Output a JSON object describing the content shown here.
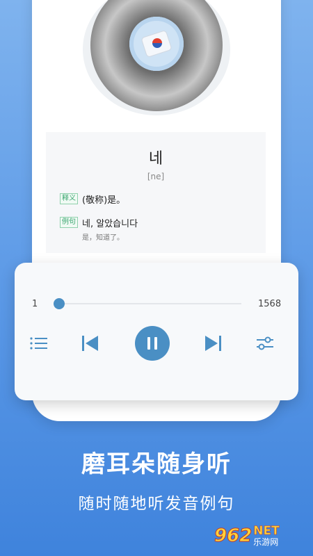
{
  "card": {
    "word": "네",
    "phonetic": "[ne]",
    "meaning_tag": "释义",
    "meaning": "(敬称)是。",
    "example_tag": "例句",
    "example": "네, 알았습니다",
    "example_translation": "是，知道了。"
  },
  "player": {
    "current": "1",
    "total": "1568",
    "progress_fraction": 0.0,
    "accent_color": "#4a8fc4",
    "icons": [
      "playlist-icon",
      "previous-icon",
      "pause-icon",
      "next-icon",
      "settings-sliders-icon"
    ]
  },
  "promo": {
    "headline": "磨耳朵随身听",
    "subline": "随时随地听发音例句"
  },
  "watermark": {
    "number": "962",
    "net": "NET",
    "site": "乐游网"
  }
}
